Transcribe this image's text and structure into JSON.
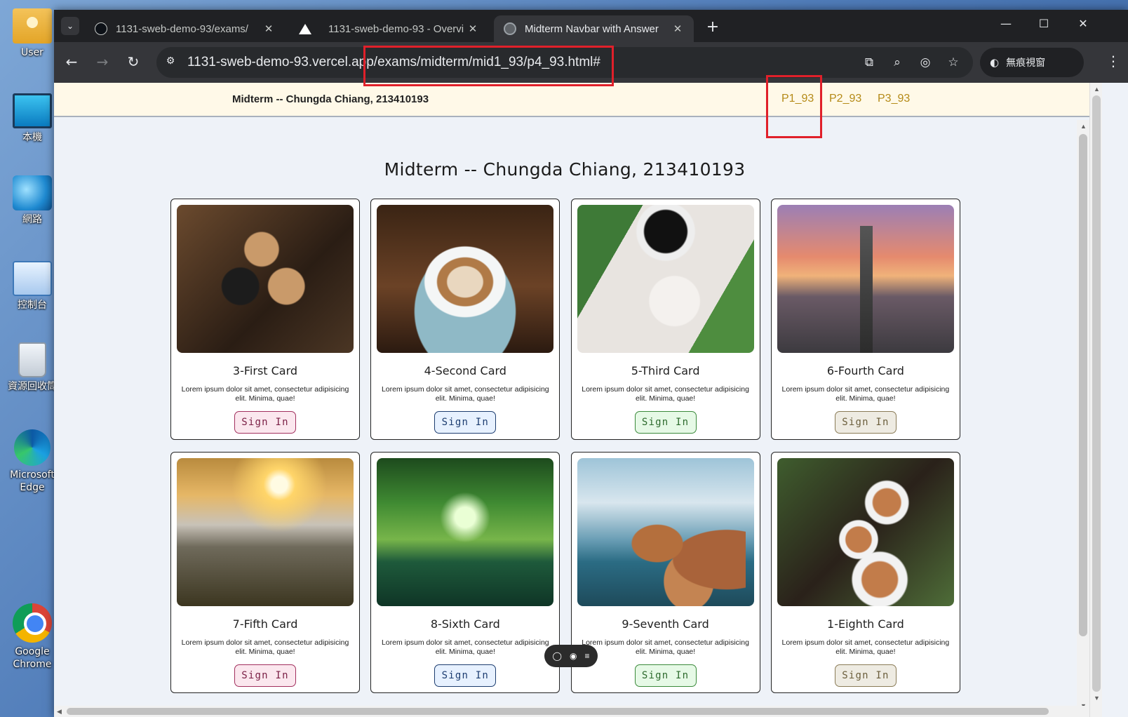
{
  "desktop": {
    "icons": [
      {
        "label": "User",
        "icon": "user-folder-icon"
      },
      {
        "label": "本機",
        "icon": "this-pc-icon"
      },
      {
        "label": "網路",
        "icon": "network-icon"
      },
      {
        "label": "控制台",
        "icon": "control-panel-icon"
      },
      {
        "label": "資源回收筒",
        "icon": "recycle-bin-icon"
      },
      {
        "label": "Microsoft Edge",
        "icon": "edge-icon"
      },
      {
        "label": "Google Chrome",
        "icon": "chrome-icon"
      }
    ]
  },
  "browser": {
    "tabs": [
      {
        "title": "1131-sweb-demo-93/exams/",
        "icon": "github-icon",
        "active": false
      },
      {
        "title": "1131-sweb-demo-93 - Overvi",
        "icon": "vercel-icon",
        "active": false
      },
      {
        "title": "Midterm Navbar with Answer",
        "icon": "globe-icon",
        "active": true
      }
    ],
    "url_host": "1131-sweb-demo-93.vercel.app",
    "url_path": "/exams/midterm/mid1_93/p4_93.html#",
    "incognito_label": "無痕視窗"
  },
  "page": {
    "brand": "Midterm -- Chungda Chiang, 213410193",
    "nav_links": [
      "P1_93",
      "P2_93",
      "P3_93"
    ],
    "heading": "Midterm -- Chungda Chiang, 213410193",
    "cards": [
      {
        "title": "3-First Card",
        "text": "Lorem ipsum dolor sit amet, consectetur adipisicing elit. Minima, quae!",
        "button": "Sign In",
        "style": "pink",
        "photo": "coffee-cheers"
      },
      {
        "title": "4-Second Card",
        "text": "Lorem ipsum dolor sit amet, consectetur adipisicing elit. Minima, quae!",
        "button": "Sign In",
        "style": "blue",
        "photo": "latte-cup"
      },
      {
        "title": "5-Third Card",
        "text": "Lorem ipsum dolor sit amet, consectetur adipisicing elit. Minima, quae!",
        "button": "Sign In",
        "style": "green",
        "photo": "coffee-leaves"
      },
      {
        "title": "6-Fourth Card",
        "text": "Lorem ipsum dolor sit amet, consectetur adipisicing elit. Minima, quae!",
        "button": "Sign In",
        "style": "tan",
        "photo": "taipei-skyline"
      },
      {
        "title": "7-Fifth Card",
        "text": "Lorem ipsum dolor sit amet, consectetur adipisicing elit. Minima, quae!",
        "button": "Sign In",
        "style": "pink",
        "photo": "mountain-sunrise"
      },
      {
        "title": "8-Sixth Card",
        "text": "Lorem ipsum dolor sit amet, consectetur adipisicing elit. Minima, quae!",
        "button": "Sign In",
        "style": "blue",
        "photo": "green-tunnel"
      },
      {
        "title": "9-Seventh Card",
        "text": "Lorem ipsum dolor sit amet, consectetur adipisicing elit. Minima, quae!",
        "button": "Sign In",
        "style": "green",
        "photo": "coastal-rocks"
      },
      {
        "title": "1-Eighth Card",
        "text": "Lorem ipsum dolor sit amet, consectetur adipisicing elit. Minima, quae!",
        "button": "Sign In",
        "style": "tan",
        "photo": "coffee-cups"
      }
    ]
  },
  "colors": {
    "navbar_bg": "#fff9e8",
    "nav_link": "#b58a17",
    "page_bg": "#eef2f8",
    "annotation_red": "#e0202a"
  }
}
